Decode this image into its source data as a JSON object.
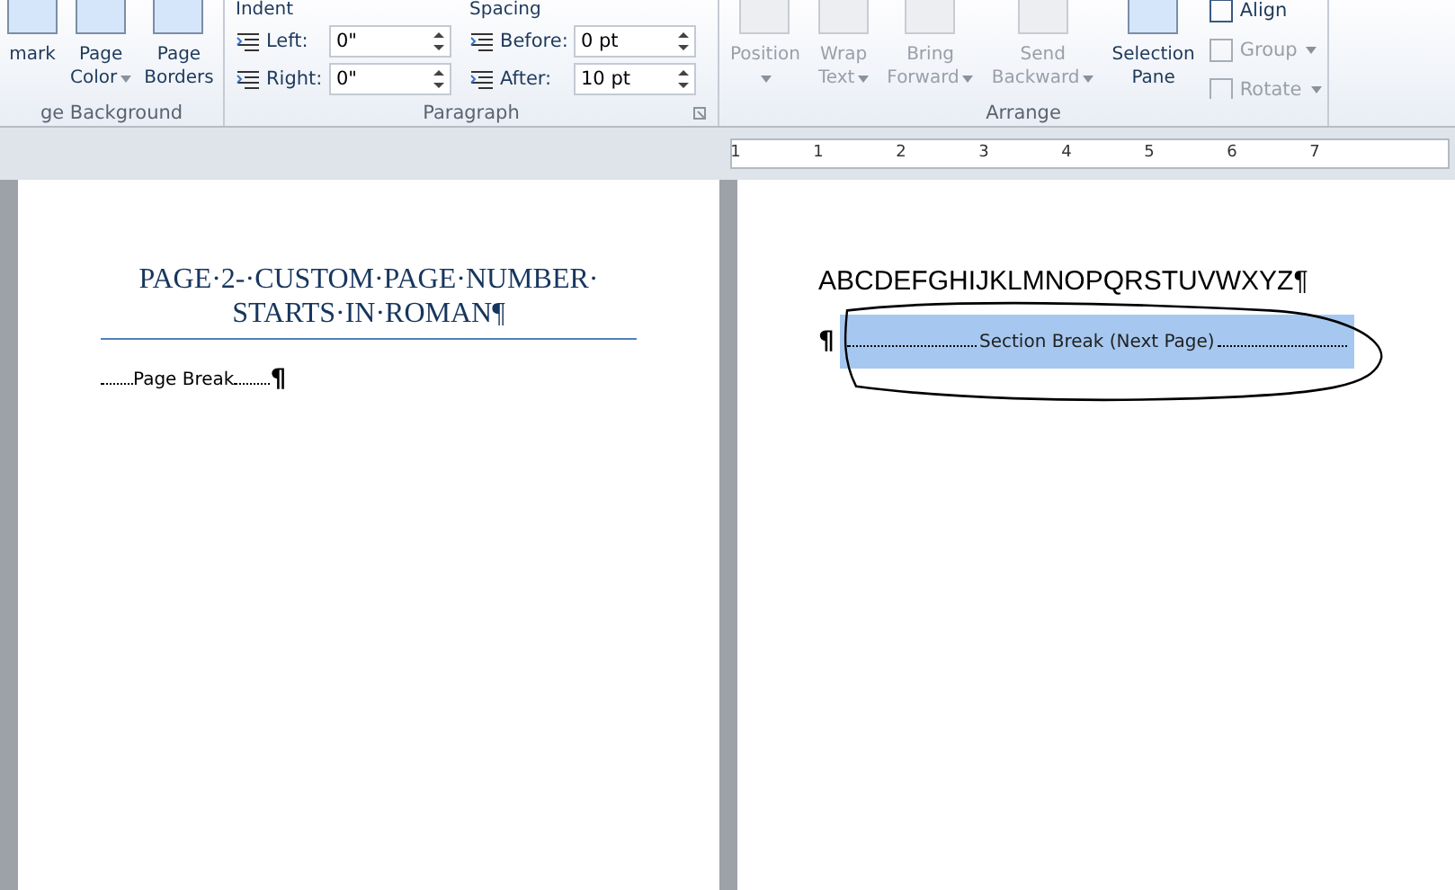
{
  "ribbon": {
    "groups": [
      {
        "kind": "buttons",
        "label": "ge Background",
        "buttons": [
          {
            "lines": [
              "mark"
            ],
            "dropdown": false,
            "disabled": false
          },
          {
            "lines": [
              "Page",
              "Color"
            ],
            "dropdown": true,
            "disabled": false
          },
          {
            "lines": [
              "Page",
              "Borders"
            ],
            "dropdown": false,
            "disabled": false
          }
        ]
      },
      {
        "kind": "fields",
        "label": "Paragraph",
        "columns": [
          {
            "heading": "Indent",
            "fields": [
              {
                "label": "Left:",
                "value": "0\""
              },
              {
                "label": "Right:",
                "value": "0\""
              }
            ]
          },
          {
            "heading": "Spacing",
            "fields": [
              {
                "label": "Before:",
                "value": "0 pt"
              },
              {
                "label": "After:",
                "value": "10 pt"
              }
            ]
          }
        ]
      },
      {
        "kind": "buttons",
        "label": "Arrange",
        "buttons": [
          {
            "lines": [
              "Position"
            ],
            "dropdown": true,
            "disabled": true
          },
          {
            "lines": [
              "Wrap",
              "Text"
            ],
            "dropdown": true,
            "disabled": true
          },
          {
            "lines": [
              "Bring",
              "Forward"
            ],
            "dropdown": true,
            "disabled": true
          },
          {
            "lines": [
              "Send",
              "Backward"
            ],
            "dropdown": true,
            "disabled": true
          },
          {
            "lines": [
              "Selection",
              "Pane"
            ],
            "dropdown": false,
            "disabled": false
          }
        ],
        "small": [
          {
            "label": "Align",
            "dropdown": false,
            "disabled": false
          },
          {
            "label": "Group",
            "dropdown": true,
            "disabled": true
          },
          {
            "label": "Rotate",
            "dropdown": true,
            "disabled": true
          }
        ]
      }
    ]
  },
  "ruler": {
    "numbers": [
      "1",
      "1",
      "2",
      "3",
      "4",
      "5",
      "6",
      "7"
    ]
  },
  "pages": [
    {
      "kind": "heading",
      "heading_lines": [
        "PAGE·2-·CUSTOM·PAGE·NUMBER·",
        "STARTS·IN·ROMAN¶"
      ],
      "break_label": "Page Break",
      "break_mark": "¶"
    },
    {
      "kind": "section",
      "text": "ABCDEFGHIJKLMNOPQRSTUVWXYZ¶",
      "break_mark": "¶",
      "break_label": "Section Break (Next Page)",
      "selected": true
    }
  ]
}
